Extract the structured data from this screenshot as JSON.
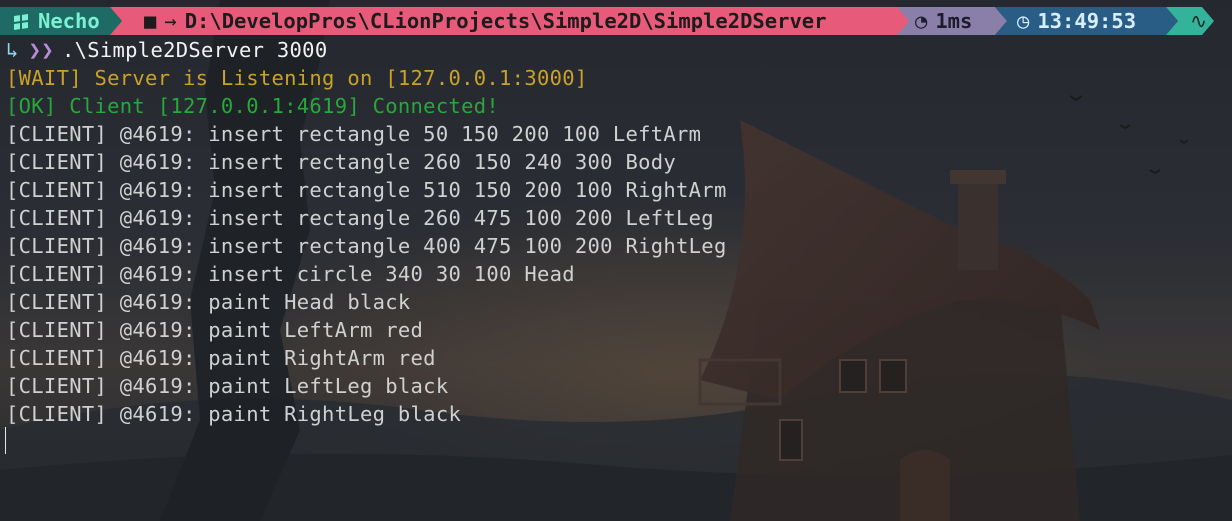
{
  "prompt": {
    "user": "Necho",
    "user_icon": "windows-icon",
    "folder_icon": "folder-icon",
    "path_arrow": "→",
    "path": "D:\\DevelopPros\\CLionProjects\\Simple2D\\Simple2DServer",
    "duration_icon": "timer-icon",
    "duration": "1ms",
    "clock_icon": "clock-icon",
    "time": "13:49:53",
    "end_icon": "pulse-icon",
    "colors": {
      "user_bg": "#1d6b64",
      "path_bg": "#e85a7a",
      "duration_bg": "#8a7fa8",
      "time_bg": "#2a5d86",
      "end_bg": "#33b49a"
    }
  },
  "command": {
    "arrow1": "↳",
    "arrow2": "❯❯",
    "name": ".\\Simple2DServer",
    "arg": "3000"
  },
  "output": [
    {
      "kind": "wait",
      "text": "[WAIT] Server is Listening on [127.0.0.1:3000]"
    },
    {
      "kind": "ok",
      "text": "[OK] Client [127.0.0.1:4619] Connected!"
    },
    {
      "kind": "client",
      "text": "[CLIENT] @4619: insert rectangle 50 150 200 100 LeftArm"
    },
    {
      "kind": "client",
      "text": "[CLIENT] @4619: insert rectangle 260 150 240 300 Body"
    },
    {
      "kind": "client",
      "text": "[CLIENT] @4619: insert rectangle 510 150 200 100 RightArm"
    },
    {
      "kind": "client",
      "text": "[CLIENT] @4619: insert rectangle 260 475 100 200 LeftLeg"
    },
    {
      "kind": "client",
      "text": "[CLIENT] @4619: insert rectangle 400 475 100 200 RightLeg"
    },
    {
      "kind": "client",
      "text": "[CLIENT] @4619: insert circle 340 30 100 Head"
    },
    {
      "kind": "client",
      "text": "[CLIENT] @4619: paint Head black"
    },
    {
      "kind": "client",
      "text": "[CLIENT] @4619: paint LeftArm red"
    },
    {
      "kind": "client",
      "text": "[CLIENT] @4619: paint RightArm red"
    },
    {
      "kind": "client",
      "text": "[CLIENT] @4619: paint LeftLeg black"
    },
    {
      "kind": "client",
      "text": "[CLIENT] @4619: paint RightLeg black"
    }
  ],
  "colors": {
    "wait": "#c9a227",
    "ok": "#27a83a",
    "client": "#d0d0d0"
  }
}
